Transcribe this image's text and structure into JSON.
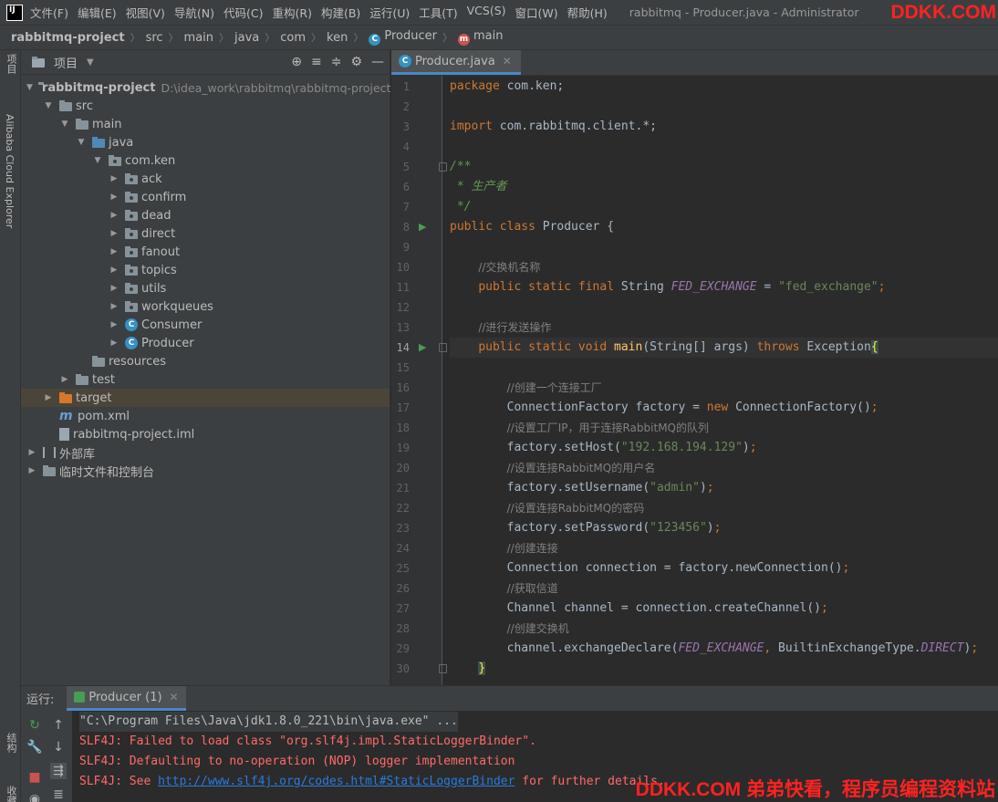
{
  "menu": [
    "文件(F)",
    "编辑(E)",
    "视图(V)",
    "导航(N)",
    "代码(C)",
    "重构(R)",
    "构建(B)",
    "运行(U)",
    "工具(T)",
    "VCS(S)",
    "窗口(W)",
    "帮助(H)"
  ],
  "window_title": "rabbitmq - Producer.java - Administrator",
  "watermark_top": "DDKK.COM",
  "breadcrumb": [
    "rabbitmq-project",
    "src",
    "main",
    "java",
    "com",
    "ken",
    "Producer",
    "main"
  ],
  "left_strip": {
    "project": "项目",
    "alibaba": "Alibaba Cloud Explorer",
    "structure": "结构",
    "bookmarks": "收藏"
  },
  "project_panel": {
    "title": "项目"
  },
  "tree": [
    {
      "label": "rabbitmq-project",
      "path": "D:\\idea_work\\rabbitmq\\rabbitmq-project",
      "depth": 0,
      "arrow": "▼",
      "icon": "folder"
    },
    {
      "label": "src",
      "depth": 1,
      "arrow": "▼",
      "icon": "folder"
    },
    {
      "label": "main",
      "depth": 2,
      "arrow": "▼",
      "icon": "folder"
    },
    {
      "label": "java",
      "depth": 3,
      "arrow": "▼",
      "icon": "folder-blue"
    },
    {
      "label": "com.ken",
      "depth": 4,
      "arrow": "▼",
      "icon": "package"
    },
    {
      "label": "ack",
      "depth": 5,
      "arrow": "▶",
      "icon": "package"
    },
    {
      "label": "confirm",
      "depth": 5,
      "arrow": "▶",
      "icon": "package"
    },
    {
      "label": "dead",
      "depth": 5,
      "arrow": "▶",
      "icon": "package"
    },
    {
      "label": "direct",
      "depth": 5,
      "arrow": "▶",
      "icon": "package"
    },
    {
      "label": "fanout",
      "depth": 5,
      "arrow": "▶",
      "icon": "package"
    },
    {
      "label": "topics",
      "depth": 5,
      "arrow": "▶",
      "icon": "package"
    },
    {
      "label": "utils",
      "depth": 5,
      "arrow": "▶",
      "icon": "package"
    },
    {
      "label": "workqueues",
      "depth": 5,
      "arrow": "▶",
      "icon": "package"
    },
    {
      "label": "Consumer",
      "depth": 5,
      "arrow": "▶",
      "icon": "class"
    },
    {
      "label": "Producer",
      "depth": 5,
      "arrow": "▶",
      "icon": "class"
    },
    {
      "label": "resources",
      "depth": 3,
      "arrow": "",
      "icon": "folder"
    },
    {
      "label": "test",
      "depth": 2,
      "arrow": "▶",
      "icon": "folder"
    },
    {
      "label": "target",
      "depth": 1,
      "arrow": "▶",
      "icon": "folder-orange",
      "selected": true
    },
    {
      "label": "pom.xml",
      "depth": 1,
      "arrow": "",
      "icon": "maven"
    },
    {
      "label": "rabbitmq-project.iml",
      "depth": 1,
      "arrow": "",
      "icon": "file"
    },
    {
      "label": "外部库",
      "depth": 0,
      "arrow": "▶",
      "icon": "library"
    },
    {
      "label": "临时文件和控制台",
      "depth": 0,
      "arrow": "▶",
      "icon": "scratch"
    }
  ],
  "editor_tab": "Producer.java",
  "current_line": 14,
  "code_lines": [
    [
      [
        "kw",
        "package "
      ],
      [
        "p",
        "com.ken;"
      ]
    ],
    [],
    [
      [
        "kw",
        "import "
      ],
      [
        "p",
        "com.rabbitmq.client.*;"
      ]
    ],
    [],
    [
      [
        "doc",
        "/**"
      ]
    ],
    [
      [
        "doc",
        " * 生产者"
      ]
    ],
    [
      [
        "doc",
        " */"
      ]
    ],
    [
      [
        "kw",
        "public class "
      ],
      [
        "p",
        "Producer {"
      ]
    ],
    [],
    [
      [
        "p",
        "    "
      ],
      [
        "cm",
        "//交换机名称"
      ]
    ],
    [
      [
        "p",
        "    "
      ],
      [
        "kw",
        "public static final "
      ],
      [
        "p",
        "String "
      ],
      [
        "ct",
        "FED_EXCHANGE"
      ],
      [
        "p",
        " = "
      ],
      [
        "st",
        "\"fed_exchange\""
      ],
      [
        "kw",
        ";"
      ]
    ],
    [],
    [
      [
        "p",
        "    "
      ],
      [
        "cm",
        "//进行发送操作"
      ]
    ],
    [
      [
        "p",
        "    "
      ],
      [
        "kw",
        "public static void "
      ],
      [
        "fn",
        "main"
      ],
      [
        "p",
        "(String[] args) "
      ],
      [
        "kw",
        "throws "
      ],
      [
        "p",
        "Exception"
      ],
      [
        "br",
        "{"
      ]
    ],
    [],
    [
      [
        "p",
        "        "
      ],
      [
        "cm",
        "//创建一个连接工厂"
      ]
    ],
    [
      [
        "p",
        "        ConnectionFactory factory = "
      ],
      [
        "kw",
        "new "
      ],
      [
        "p",
        "ConnectionFactory()"
      ],
      [
        "kw",
        ";"
      ]
    ],
    [
      [
        "p",
        "        "
      ],
      [
        "cm",
        "//设置工厂IP，用于连接RabbitMQ的队列"
      ]
    ],
    [
      [
        "p",
        "        factory.setHost("
      ],
      [
        "st",
        "\"192.168.194.129\""
      ],
      [
        "p",
        ")"
      ],
      [
        "kw",
        ";"
      ]
    ],
    [
      [
        "p",
        "        "
      ],
      [
        "cm",
        "//设置连接RabbitMQ的用户名"
      ]
    ],
    [
      [
        "p",
        "        factory.setUsername("
      ],
      [
        "st",
        "\"admin\""
      ],
      [
        "p",
        ")"
      ],
      [
        "kw",
        ";"
      ]
    ],
    [
      [
        "p",
        "        "
      ],
      [
        "cm",
        "//设置连接RabbitMQ的密码"
      ]
    ],
    [
      [
        "p",
        "        factory.setPassword("
      ],
      [
        "st",
        "\"123456\""
      ],
      [
        "p",
        ")"
      ],
      [
        "kw",
        ";"
      ]
    ],
    [
      [
        "p",
        "        "
      ],
      [
        "cm",
        "//创建连接"
      ]
    ],
    [
      [
        "p",
        "        Connection connection = factory.newConnection()"
      ],
      [
        "kw",
        ";"
      ]
    ],
    [
      [
        "p",
        "        "
      ],
      [
        "cm",
        "//获取信道"
      ]
    ],
    [
      [
        "p",
        "        Channel channel = connection.createChannel()"
      ],
      [
        "kw",
        ";"
      ]
    ],
    [
      [
        "p",
        "        "
      ],
      [
        "cm",
        "//创建交换机"
      ]
    ],
    [
      [
        "p",
        "        channel.exchangeDeclare("
      ],
      [
        "ct",
        "FED_EXCHANGE"
      ],
      [
        "kw",
        ", "
      ],
      [
        "p",
        "BuiltinExchangeType."
      ],
      [
        "ct",
        "DIRECT"
      ],
      [
        "p",
        ")"
      ],
      [
        "kw",
        ";"
      ]
    ],
    [
      [
        "p",
        "    "
      ],
      [
        "br",
        "}"
      ]
    ]
  ],
  "run_lines": [
    8,
    14
  ],
  "fold_lines": [
    5,
    14,
    30
  ],
  "run_panel": {
    "label": "运行:",
    "tab": "Producer (1)"
  },
  "console": [
    {
      "kind": "cmd",
      "text": "\"C:\\Program Files\\Java\\jdk1.8.0_221\\bin\\java.exe\" ..."
    },
    {
      "kind": "err",
      "text": "SLF4J: Failed to load class \"org.slf4j.impl.StaticLoggerBinder\"."
    },
    {
      "kind": "err",
      "text": "SLF4J: Defaulting to no-operation (NOP) logger implementation"
    },
    {
      "kind": "err-link",
      "prefix": "SLF4J: See ",
      "link": "http://www.slf4j.org/codes.html#StaticLoggerBinder",
      "suffix": " for further details."
    }
  ],
  "watermark_bottom": "DDKK.COM 弟弟快看，程序员编程资料站",
  "colors": {
    "accent": "#4a88c7",
    "error": "#ff6b68",
    "keyword": "#cc7832",
    "string": "#6a8759"
  }
}
